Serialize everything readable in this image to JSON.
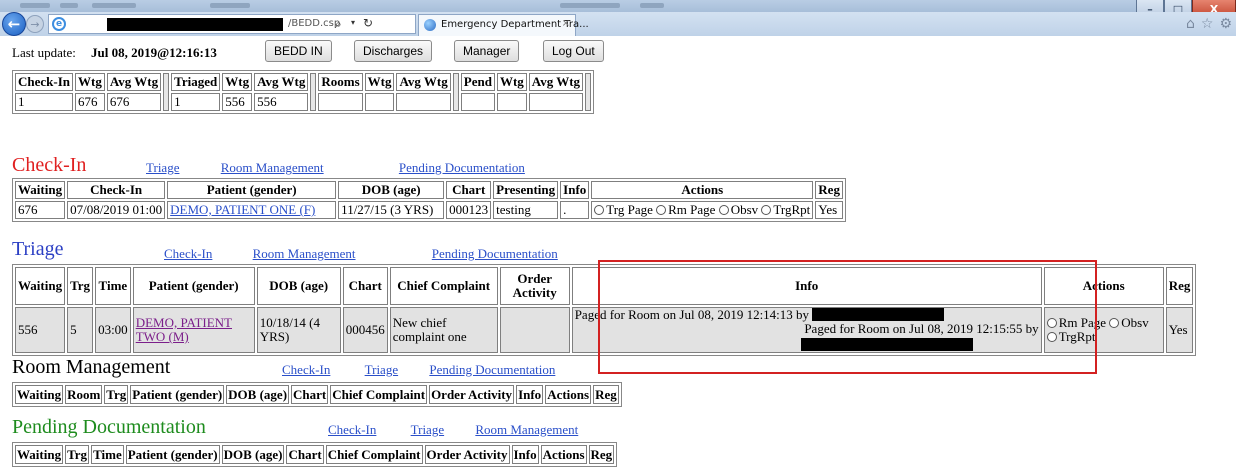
{
  "browser": {
    "url_tail": "/BEDD.csp",
    "tab_title": "Emergency Department Tra...",
    "tab_close": "×",
    "window_controls": [
      "–",
      "□",
      "X"
    ],
    "icons": [
      "home-icon",
      "star-icon",
      "gear-icon"
    ]
  },
  "header": {
    "last_update_label": "Last update:",
    "last_update_value": "Jul 08, 2019@12:16:13",
    "buttons": [
      "BEDD IN",
      "Discharges",
      "Manager",
      "Log Out"
    ]
  },
  "summary": {
    "groups": [
      {
        "headers": [
          "Check-In",
          "Wtg",
          "Avg Wtg"
        ],
        "values": [
          "1",
          "676",
          "676"
        ]
      },
      {
        "headers": [
          "Triaged",
          "Wtg",
          "Avg Wtg"
        ],
        "values": [
          "1",
          "556",
          "556"
        ]
      },
      {
        "headers": [
          "Rooms",
          "Wtg",
          "Avg Wtg"
        ],
        "values": [
          "",
          "",
          ""
        ]
      },
      {
        "headers": [
          "Pend",
          "Wtg",
          "Avg Wtg"
        ],
        "values": [
          "",
          "",
          ""
        ]
      }
    ]
  },
  "checkin": {
    "title": "Check-In",
    "title_color": "#e02020",
    "links": [
      "Triage",
      "Room Management",
      "Pending Documentation"
    ],
    "headers": [
      "Waiting",
      "Check-In",
      "Patient (gender)",
      "DOB (age)",
      "Chart",
      "Presenting",
      "Info",
      "Actions",
      "Reg"
    ],
    "row": {
      "waiting": "676",
      "checkin": "07/08/2019 01:00",
      "patient": "DEMO, PATIENT ONE (F)",
      "dob": "11/27/15 (3 YRS)",
      "chart": "000123",
      "presenting": "testing",
      "info": ".",
      "actions": [
        "Trg Page",
        "Rm Page",
        "Obsv",
        "TrgRpt"
      ],
      "reg": "Yes"
    }
  },
  "triage": {
    "title": "Triage",
    "title_color": "#2b3fc4",
    "links": [
      "Check-In",
      "Room Management",
      "Pending Documentation"
    ],
    "headers": [
      "Waiting",
      "Trg",
      "Time",
      "Patient (gender)",
      "DOB (age)",
      "Chart",
      "Chief Complaint",
      "Order Activity",
      "Info",
      "Actions",
      "Reg"
    ],
    "row": {
      "waiting": "556",
      "trg": "5",
      "time": "03:00",
      "patient": "DEMO, PATIENT TWO (M)",
      "dob": "10/18/14 (4 YRS)",
      "chart": "000456",
      "chief_complaint": "New chief complaint one",
      "order_activity": "",
      "info_part1": "Paged for Room on Jul 08, 2019 12:14:13 by",
      "info_part2": "Paged for Room on Jul 08, 2019 12:15:55 by",
      "actions": [
        "Rm Page",
        "Obsv",
        "TrgRpt"
      ],
      "reg": "Yes"
    },
    "highlight_color": "#d32121"
  },
  "room_management": {
    "title": "Room Management",
    "title_color": "#000000",
    "links": [
      "Check-In",
      "Triage",
      "Pending Documentation"
    ],
    "headers": [
      "Waiting",
      "Room",
      "Trg",
      "Patient (gender)",
      "DOB (age)",
      "Chart",
      "Chief Complaint",
      "Order Activity",
      "Info",
      "Actions",
      "Reg"
    ]
  },
  "pending": {
    "title": "Pending Documentation",
    "title_color": "#1e8c1e",
    "links": [
      "Check-In",
      "Triage",
      "Room Management"
    ],
    "headers": [
      "Waiting",
      "Trg",
      "Time",
      "Patient (gender)",
      "DOB (age)",
      "Chart",
      "Chief Complaint",
      "Order Activity",
      "Info",
      "Actions",
      "Reg"
    ]
  }
}
